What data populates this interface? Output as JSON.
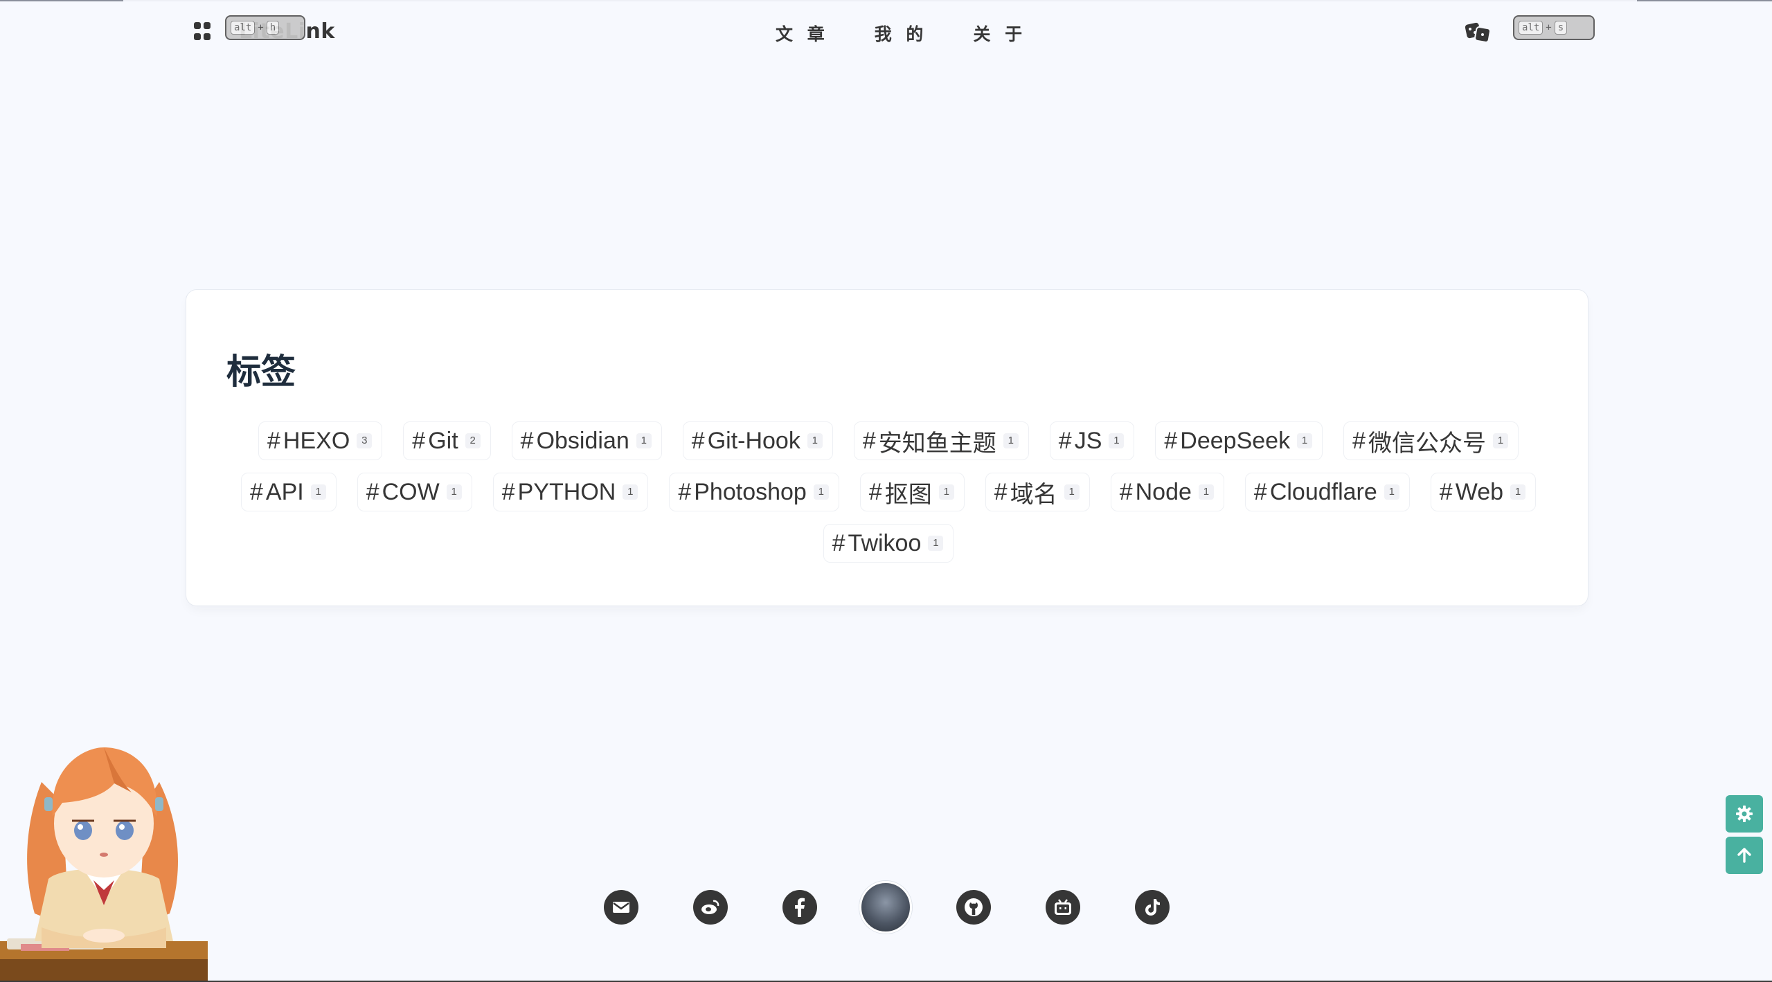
{
  "header": {
    "logo": "LiteLink",
    "kbd_left": {
      "key1": "alt",
      "key2": "h"
    },
    "kbd_right": {
      "key1": "alt",
      "key2": "s"
    },
    "nav": [
      "文 章",
      "我 的",
      "关 于"
    ]
  },
  "tags_card": {
    "title": "标签",
    "tags": [
      {
        "name": "HEXO",
        "count": "3"
      },
      {
        "name": "Git",
        "count": "2"
      },
      {
        "name": "Obsidian",
        "count": "1"
      },
      {
        "name": "Git-Hook",
        "count": "1"
      },
      {
        "name": "安知鱼主题",
        "count": "1"
      },
      {
        "name": "JS",
        "count": "1"
      },
      {
        "name": "DeepSeek",
        "count": "1"
      },
      {
        "name": "微信公众号",
        "count": "1"
      },
      {
        "name": "API",
        "count": "1"
      },
      {
        "name": "COW",
        "count": "1"
      },
      {
        "name": "PYTHON",
        "count": "1"
      },
      {
        "name": "Photoshop",
        "count": "1"
      },
      {
        "name": "抠图",
        "count": "1"
      },
      {
        "name": "域名",
        "count": "1"
      },
      {
        "name": "Node",
        "count": "1"
      },
      {
        "name": "Cloudflare",
        "count": "1"
      },
      {
        "name": "Web",
        "count": "1"
      },
      {
        "name": "Twikoo",
        "count": "1"
      }
    ]
  },
  "footer": {
    "social_icons": [
      "email-icon",
      "weibo-icon",
      "facebook-icon",
      "avatar",
      "github-icon",
      "bilibili-icon",
      "tiktok-icon"
    ]
  },
  "colors": {
    "accent": "#49b1a0",
    "text": "#363636",
    "background": "#f7f9fe"
  }
}
